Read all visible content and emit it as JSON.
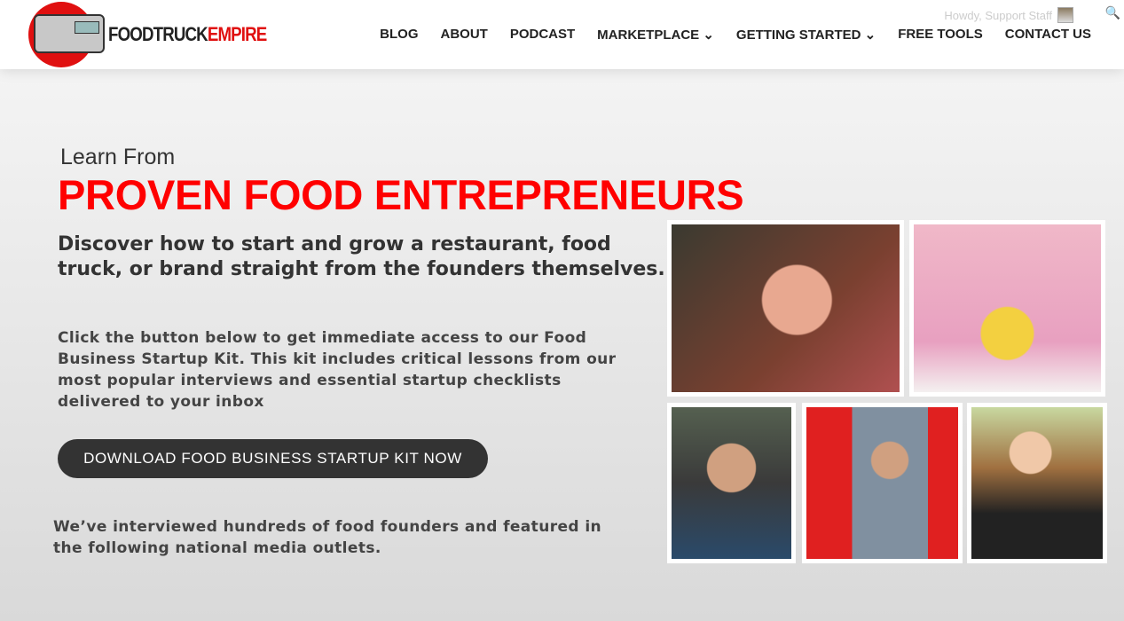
{
  "header": {
    "logo": {
      "text_a": "FOODTRUCK",
      "text_b": "EMPIRE"
    },
    "nav": [
      "BLOG",
      "ABOUT",
      "PODCAST",
      "MARKETPLACE ⌄",
      "GETTING STARTED ⌄",
      "FREE TOOLS",
      "CONTACT US"
    ],
    "howdy": "Howdy, Support Staff",
    "search_icon": "🔍"
  },
  "hero": {
    "learn": "Learn From",
    "title": "PROVEN FOOD ENTREPRENEURS",
    "subtitle": "Discover how to start and grow a restaurant, food truck, or brand straight from the founders themselves.",
    "body": "Click the button below to get immediate access to our Food Business Startup Kit. This kit includes critical lessons from our most popular interviews and essential startup checklists delivered to your inbox",
    "cta": "DOWNLOAD FOOD BUSINESS STARTUP KIT NOW",
    "media": "We’ve interviewed hundreds of food founders and featured in the following national media outlets."
  },
  "colors": {
    "accent": "#ff0000",
    "button": "#333333"
  }
}
